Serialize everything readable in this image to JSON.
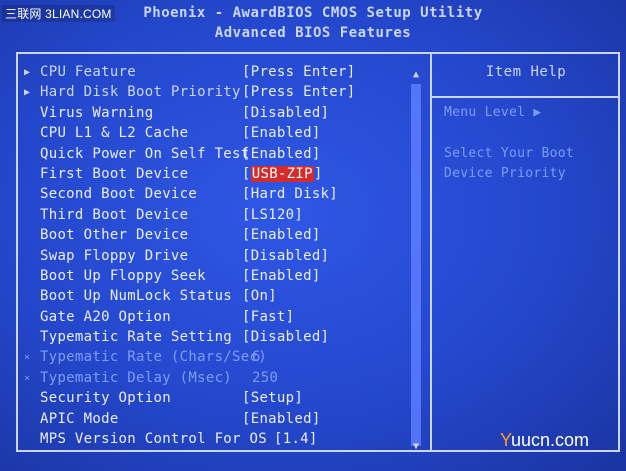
{
  "watermark_top": "三联网 3LIAN.COM",
  "header": {
    "title": "Phoenix - AwardBIOS CMOS Setup Utility",
    "subtitle": "Advanced BIOS Features"
  },
  "items": [
    {
      "marker": "▶",
      "label": "CPU Feature",
      "value": "[Press Enter]"
    },
    {
      "marker": "▶",
      "label": "Hard Disk Boot Priority",
      "value": "[Press Enter]"
    },
    {
      "marker": "",
      "label": "Virus Warning",
      "value": "[Disabled]"
    },
    {
      "marker": "",
      "label": "CPU L1 & L2 Cache",
      "value": "[Enabled]"
    },
    {
      "marker": "",
      "label": "Quick Power On Self Test",
      "value": "[Enabled]"
    },
    {
      "marker": "",
      "label": "First Boot Device",
      "value_prefix": "[",
      "value_selected": "USB-ZIP",
      "value_suffix": "]"
    },
    {
      "marker": "",
      "label": "Second Boot Device",
      "value": "[Hard Disk]"
    },
    {
      "marker": "",
      "label": "Third Boot Device",
      "value": "[LS120]"
    },
    {
      "marker": "",
      "label": "Boot Other Device",
      "value": "[Enabled]"
    },
    {
      "marker": "",
      "label": "Swap Floppy Drive",
      "value": "[Disabled]"
    },
    {
      "marker": "",
      "label": "Boot Up Floppy Seek",
      "value": "[Enabled]"
    },
    {
      "marker": "",
      "label": "Boot Up NumLock Status",
      "value": "[On]"
    },
    {
      "marker": "",
      "label": "Gate A20 Option",
      "value": "[Fast]"
    },
    {
      "marker": "",
      "label": "Typematic Rate Setting",
      "value": "[Disabled]"
    },
    {
      "marker": "×",
      "label": "Typematic Rate (Chars/Sec)",
      "value": "6"
    },
    {
      "marker": "×",
      "label": "Typematic Delay (Msec)",
      "value": "250"
    },
    {
      "marker": "",
      "label": "Security Option",
      "value": "[Setup]"
    },
    {
      "marker": "",
      "label": "APIC Mode",
      "value": "[Enabled]"
    },
    {
      "marker": "",
      "label": "MPS Version Control For OS",
      "value": "[1.4]"
    }
  ],
  "scroll": {
    "up": "▲",
    "down": "▼"
  },
  "help": {
    "title": "Item Help",
    "menu_level": "Menu Level   ▶",
    "line1": "Select Your Boot",
    "line2": "Device Priority"
  },
  "watermark_bottom": {
    "y": "Y",
    "rest": "uucn.com"
  },
  "colors": {
    "background": "#2447cc",
    "text": "#e9eeff",
    "dim_text": "#7f9bff",
    "frame": "#c9d6ff",
    "selection": "#d62b2b"
  }
}
